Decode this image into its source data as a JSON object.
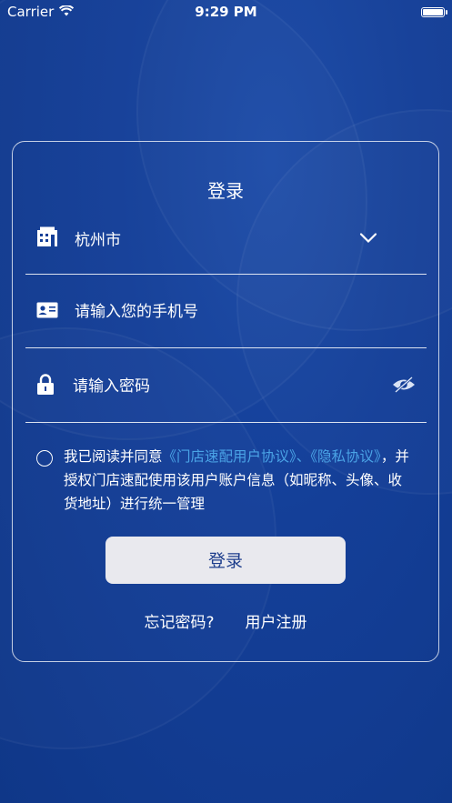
{
  "status": {
    "carrier": "Carrier",
    "time": "9:29 PM"
  },
  "login": {
    "title": "登录",
    "city": "杭州市",
    "phone_placeholder": "请输入您的手机号",
    "password_placeholder": "请输入密码",
    "agreement": {
      "prefix": "我已阅读并同意",
      "link1": "《门店速配用户协议》",
      "sep": "、",
      "link2": "《隐私协议》",
      "suffix": "，并授权门店速配使用该用户账户信息（如昵称、头像、收货地址）进行统一管理"
    },
    "submit": "登录",
    "forgot": "忘记密码?",
    "register": "用户注册"
  },
  "colors": {
    "background": "#123a8f",
    "link": "#4aa3e6",
    "button": "#e9e9ee",
    "button_text": "#1d3d8c"
  }
}
